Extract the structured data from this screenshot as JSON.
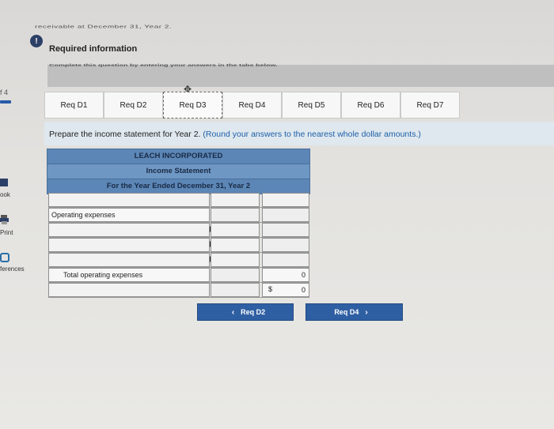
{
  "header": {
    "cut_text": "receivable at December 31, Year 2.",
    "required_info_label": "Required information",
    "info_badge": "!",
    "cut_text_2": "Complete this question by entering your answers in the tabs below."
  },
  "sidebar": {
    "page_num": "f 4",
    "items": [
      {
        "label": "ook"
      },
      {
        "label": "Print"
      },
      {
        "label": "ferences"
      }
    ]
  },
  "tabs": [
    {
      "label": "Req D1"
    },
    {
      "label": "Req D2"
    },
    {
      "label": "Req D3"
    },
    {
      "label": "Req D4"
    },
    {
      "label": "Req D5"
    },
    {
      "label": "Req D6"
    },
    {
      "label": "Req D7"
    }
  ],
  "active_tab": "Req D3",
  "instructions": {
    "main": "Prepare the income statement for Year 2.",
    "hint": "(Round your answers to the nearest whole dollar amounts.)"
  },
  "statement": {
    "company": "LEACH INCORPORATED",
    "title": "Income Statement",
    "period": "For the Year Ended December 31, Year 2"
  },
  "rows": {
    "operating_expenses_label": "Operating expenses",
    "total_operating_label": "Total operating expenses",
    "total_operating_value": "0",
    "final_dollar": "$",
    "final_value": "0"
  },
  "nav": {
    "prev_label": "Req D2",
    "next_label": "Req D4"
  }
}
